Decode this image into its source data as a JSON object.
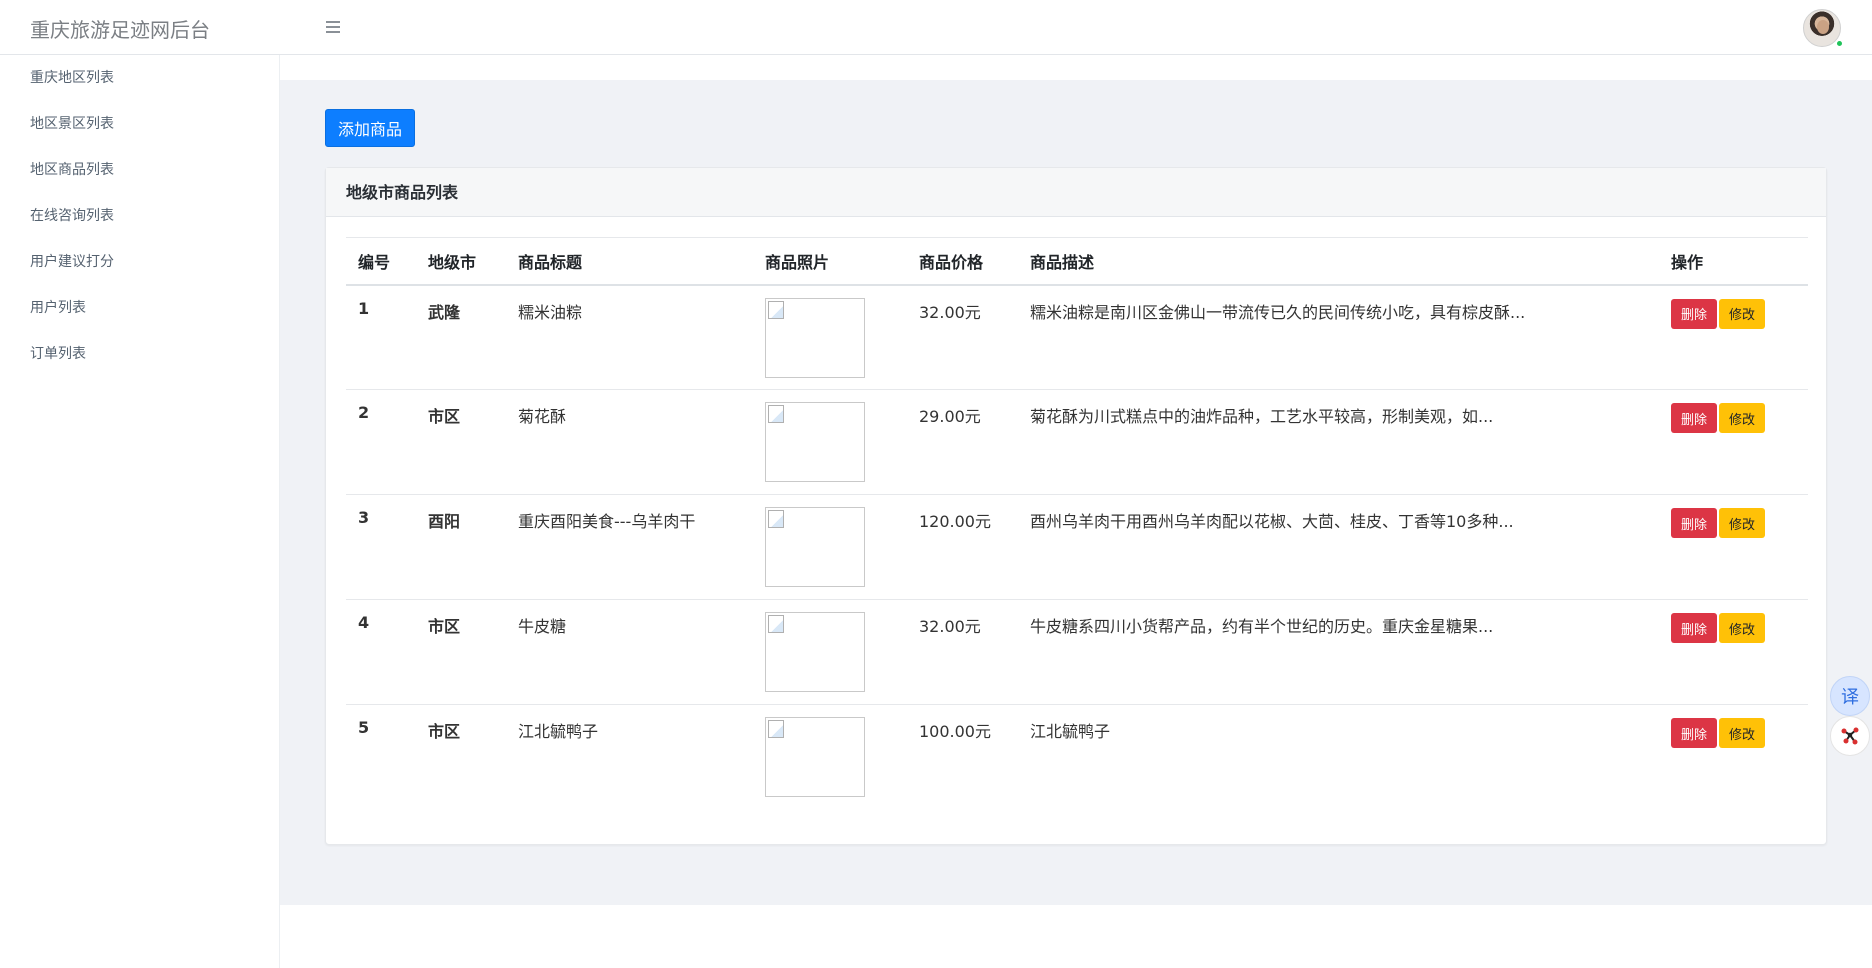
{
  "header": {
    "brand": "重庆旅游足迹网后台",
    "menu_icon": "hamburger-icon",
    "avatar_icon": "user-avatar"
  },
  "sidebar": {
    "items": [
      {
        "label": "重庆地区列表"
      },
      {
        "label": "地区景区列表"
      },
      {
        "label": "地区商品列表"
      },
      {
        "label": "在线咨询列表"
      },
      {
        "label": "用户建议打分"
      },
      {
        "label": "用户列表"
      },
      {
        "label": "订单列表"
      }
    ]
  },
  "main": {
    "add_button": "添加商品",
    "card_title": "地级市商品列表",
    "columns": [
      "编号",
      "地级市",
      "商品标题",
      "商品照片",
      "商品价格",
      "商品描述",
      "操作"
    ],
    "rows": [
      {
        "id": "1",
        "city": "武隆",
        "title": "糯米油粽",
        "price": "32.00元",
        "desc": "糯米油粽是南川区金佛山一带流传已久的民间传统小吃，具有棕皮酥..."
      },
      {
        "id": "2",
        "city": "市区",
        "title": "菊花酥",
        "price": "29.00元",
        "desc": "菊花酥为川式糕点中的油炸品种，工艺水平较高，形制美观，如..."
      },
      {
        "id": "3",
        "city": "酉阳",
        "title": "重庆酉阳美食---乌羊肉干",
        "price": "120.00元",
        "desc": "酉州乌羊肉干用酉州乌羊肉配以花椒、大茴、桂皮、丁香等10多种..."
      },
      {
        "id": "4",
        "city": "市区",
        "title": "牛皮糖",
        "price": "32.00元",
        "desc": "牛皮糖系四川小货帮产品，约有半个世纪的历史。重庆金星糖果..."
      },
      {
        "id": "5",
        "city": "市区",
        "title": "江北毓鸭子",
        "price": "100.00元",
        "desc": "江北毓鸭子"
      }
    ],
    "delete_label": "删除",
    "edit_label": "修改"
  },
  "floating": {
    "translate_label": "译"
  },
  "colors": {
    "primary": "#0d7eff",
    "danger": "#dc3545",
    "warning": "#ffc107",
    "content_bg": "#f0f2f6"
  }
}
